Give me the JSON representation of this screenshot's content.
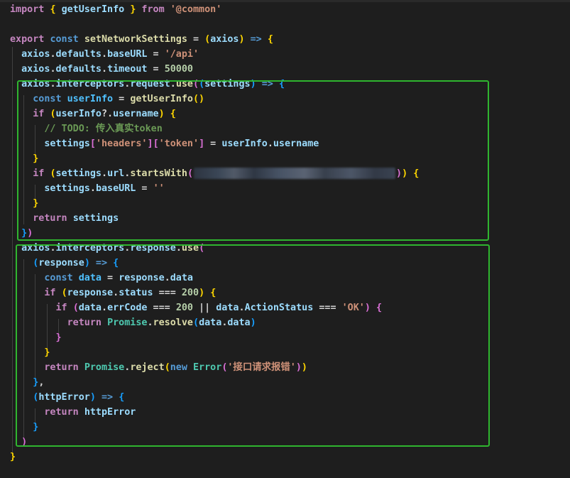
{
  "colors": {
    "background": "#1e1e1e",
    "keyword_purple": "#c586c0",
    "keyword_blue": "#569cd6",
    "variable": "#9cdcfe",
    "function": "#dcdcaa",
    "string": "#ce9178",
    "number": "#b5cea8",
    "comment": "#6a9955",
    "class": "#4ec9b0",
    "bracket_gold": "#ffd700",
    "bracket_pink": "#da70d6",
    "bracket_blue": "#179fff",
    "highlight_box": "#2fb52f"
  },
  "code": {
    "lines": [
      {
        "tokens": [
          {
            "t": "import ",
            "c": "#c586c0"
          },
          {
            "t": "{",
            "c": "#ffd700"
          },
          {
            "t": " ",
            "c": "#d4d4d4"
          },
          {
            "t": "getUserInfo",
            "c": "#9cdcfe"
          },
          {
            "t": " ",
            "c": "#d4d4d4"
          },
          {
            "t": "}",
            "c": "#ffd700"
          },
          {
            "t": " from ",
            "c": "#c586c0"
          },
          {
            "t": "'@common'",
            "c": "#ce9178"
          }
        ]
      },
      {
        "tokens": []
      },
      {
        "tokens": [
          {
            "t": "export ",
            "c": "#c586c0"
          },
          {
            "t": "const ",
            "c": "#569cd6"
          },
          {
            "t": "setNetworkSettings",
            "c": "#dcdcaa"
          },
          {
            "t": " = ",
            "c": "#d4d4d4"
          },
          {
            "t": "(",
            "c": "#ffd700"
          },
          {
            "t": "axios",
            "c": "#9cdcfe"
          },
          {
            "t": ")",
            "c": "#ffd700"
          },
          {
            "t": " => ",
            "c": "#569cd6"
          },
          {
            "t": "{",
            "c": "#ffd700"
          }
        ]
      },
      {
        "tokens": [
          {
            "t": "  axios",
            "c": "#9cdcfe"
          },
          {
            "t": ".",
            "c": "#d4d4d4"
          },
          {
            "t": "defaults",
            "c": "#9cdcfe"
          },
          {
            "t": ".",
            "c": "#d4d4d4"
          },
          {
            "t": "baseURL",
            "c": "#9cdcfe"
          },
          {
            "t": " = ",
            "c": "#d4d4d4"
          },
          {
            "t": "'/api'",
            "c": "#ce9178"
          }
        ]
      },
      {
        "tokens": [
          {
            "t": "  axios",
            "c": "#9cdcfe"
          },
          {
            "t": ".",
            "c": "#d4d4d4"
          },
          {
            "t": "defaults",
            "c": "#9cdcfe"
          },
          {
            "t": ".",
            "c": "#d4d4d4"
          },
          {
            "t": "timeout",
            "c": "#9cdcfe"
          },
          {
            "t": " = ",
            "c": "#d4d4d4"
          },
          {
            "t": "50000",
            "c": "#b5cea8"
          }
        ]
      },
      {
        "tokens": [
          {
            "t": "  axios",
            "c": "#9cdcfe"
          },
          {
            "t": ".",
            "c": "#d4d4d4"
          },
          {
            "t": "interceptors",
            "c": "#9cdcfe"
          },
          {
            "t": ".",
            "c": "#d4d4d4"
          },
          {
            "t": "request",
            "c": "#9cdcfe"
          },
          {
            "t": ".",
            "c": "#d4d4d4"
          },
          {
            "t": "use",
            "c": "#dcdcaa"
          },
          {
            "t": "(",
            "c": "#da70d6"
          },
          {
            "t": "(",
            "c": "#179fff"
          },
          {
            "t": "settings",
            "c": "#9cdcfe"
          },
          {
            "t": ")",
            "c": "#179fff"
          },
          {
            "t": " => ",
            "c": "#569cd6"
          },
          {
            "t": "{",
            "c": "#179fff"
          }
        ]
      },
      {
        "tokens": [
          {
            "t": "    const ",
            "c": "#569cd6"
          },
          {
            "t": "userInfo",
            "c": "#4fc1ff"
          },
          {
            "t": " = ",
            "c": "#d4d4d4"
          },
          {
            "t": "getUserInfo",
            "c": "#dcdcaa"
          },
          {
            "t": "()",
            "c": "#ffd700"
          }
        ]
      },
      {
        "tokens": [
          {
            "t": "    if ",
            "c": "#c586c0"
          },
          {
            "t": "(",
            "c": "#ffd700"
          },
          {
            "t": "userInfo",
            "c": "#9cdcfe"
          },
          {
            "t": "?.",
            "c": "#d4d4d4"
          },
          {
            "t": "username",
            "c": "#9cdcfe"
          },
          {
            "t": ")",
            "c": "#ffd700"
          },
          {
            "t": " ",
            "c": "#d4d4d4"
          },
          {
            "t": "{",
            "c": "#ffd700"
          }
        ]
      },
      {
        "tokens": [
          {
            "t": "      // TODO: 传入真实token",
            "c": "#6a9955"
          }
        ]
      },
      {
        "tokens": [
          {
            "t": "      settings",
            "c": "#9cdcfe"
          },
          {
            "t": "[",
            "c": "#da70d6"
          },
          {
            "t": "'headers'",
            "c": "#ce9178"
          },
          {
            "t": "]",
            "c": "#da70d6"
          },
          {
            "t": "[",
            "c": "#da70d6"
          },
          {
            "t": "'token'",
            "c": "#ce9178"
          },
          {
            "t": "]",
            "c": "#da70d6"
          },
          {
            "t": " = ",
            "c": "#d4d4d4"
          },
          {
            "t": "userInfo",
            "c": "#9cdcfe"
          },
          {
            "t": ".",
            "c": "#d4d4d4"
          },
          {
            "t": "username",
            "c": "#9cdcfe"
          }
        ]
      },
      {
        "tokens": [
          {
            "t": "    }",
            "c": "#ffd700"
          }
        ]
      },
      {
        "tokens": [
          {
            "t": "    if ",
            "c": "#c586c0"
          },
          {
            "t": "(",
            "c": "#ffd700"
          },
          {
            "t": "settings",
            "c": "#9cdcfe"
          },
          {
            "t": ".",
            "c": "#d4d4d4"
          },
          {
            "t": "url",
            "c": "#9cdcfe"
          },
          {
            "t": ".",
            "c": "#d4d4d4"
          },
          {
            "t": "startsWith",
            "c": "#dcdcaa"
          },
          {
            "t": "(",
            "c": "#da70d6"
          },
          {
            "t": "",
            "c": "#ce9178",
            "blur": true
          },
          {
            "t": ")",
            "c": "#da70d6"
          },
          {
            "t": ")",
            "c": "#ffd700"
          },
          {
            "t": " ",
            "c": "#d4d4d4"
          },
          {
            "t": "{",
            "c": "#ffd700"
          }
        ]
      },
      {
        "tokens": [
          {
            "t": "      settings",
            "c": "#9cdcfe"
          },
          {
            "t": ".",
            "c": "#d4d4d4"
          },
          {
            "t": "baseURL",
            "c": "#9cdcfe"
          },
          {
            "t": " = ",
            "c": "#d4d4d4"
          },
          {
            "t": "''",
            "c": "#ce9178"
          }
        ]
      },
      {
        "tokens": [
          {
            "t": "    }",
            "c": "#ffd700"
          }
        ]
      },
      {
        "tokens": [
          {
            "t": "    return ",
            "c": "#c586c0"
          },
          {
            "t": "settings",
            "c": "#9cdcfe"
          }
        ]
      },
      {
        "tokens": [
          {
            "t": "  }",
            "c": "#179fff"
          },
          {
            "t": ")",
            "c": "#da70d6"
          }
        ]
      },
      {
        "tokens": [
          {
            "t": "  axios",
            "c": "#9cdcfe"
          },
          {
            "t": ".",
            "c": "#d4d4d4"
          },
          {
            "t": "interceptors",
            "c": "#9cdcfe"
          },
          {
            "t": ".",
            "c": "#d4d4d4"
          },
          {
            "t": "response",
            "c": "#9cdcfe"
          },
          {
            "t": ".",
            "c": "#d4d4d4"
          },
          {
            "t": "use",
            "c": "#dcdcaa"
          },
          {
            "t": "(",
            "c": "#da70d6"
          }
        ]
      },
      {
        "tokens": [
          {
            "t": "    ",
            "c": "#d4d4d4"
          },
          {
            "t": "(",
            "c": "#179fff"
          },
          {
            "t": "response",
            "c": "#9cdcfe"
          },
          {
            "t": ")",
            "c": "#179fff"
          },
          {
            "t": " => ",
            "c": "#569cd6"
          },
          {
            "t": "{",
            "c": "#179fff"
          }
        ]
      },
      {
        "tokens": [
          {
            "t": "      const ",
            "c": "#569cd6"
          },
          {
            "t": "data",
            "c": "#4fc1ff"
          },
          {
            "t": " = ",
            "c": "#d4d4d4"
          },
          {
            "t": "response",
            "c": "#9cdcfe"
          },
          {
            "t": ".",
            "c": "#d4d4d4"
          },
          {
            "t": "data",
            "c": "#9cdcfe"
          }
        ]
      },
      {
        "tokens": [
          {
            "t": "      if ",
            "c": "#c586c0"
          },
          {
            "t": "(",
            "c": "#ffd700"
          },
          {
            "t": "response",
            "c": "#9cdcfe"
          },
          {
            "t": ".",
            "c": "#d4d4d4"
          },
          {
            "t": "status",
            "c": "#9cdcfe"
          },
          {
            "t": " === ",
            "c": "#d4d4d4"
          },
          {
            "t": "200",
            "c": "#b5cea8"
          },
          {
            "t": ")",
            "c": "#ffd700"
          },
          {
            "t": " ",
            "c": "#d4d4d4"
          },
          {
            "t": "{",
            "c": "#ffd700"
          }
        ]
      },
      {
        "tokens": [
          {
            "t": "        if ",
            "c": "#c586c0"
          },
          {
            "t": "(",
            "c": "#da70d6"
          },
          {
            "t": "data",
            "c": "#9cdcfe"
          },
          {
            "t": ".",
            "c": "#d4d4d4"
          },
          {
            "t": "errCode",
            "c": "#9cdcfe"
          },
          {
            "t": " === ",
            "c": "#d4d4d4"
          },
          {
            "t": "200",
            "c": "#b5cea8"
          },
          {
            "t": " || ",
            "c": "#d4d4d4"
          },
          {
            "t": "data",
            "c": "#9cdcfe"
          },
          {
            "t": ".",
            "c": "#d4d4d4"
          },
          {
            "t": "ActionStatus",
            "c": "#9cdcfe"
          },
          {
            "t": " === ",
            "c": "#d4d4d4"
          },
          {
            "t": "'OK'",
            "c": "#ce9178"
          },
          {
            "t": ")",
            "c": "#da70d6"
          },
          {
            "t": " ",
            "c": "#d4d4d4"
          },
          {
            "t": "{",
            "c": "#da70d6"
          }
        ]
      },
      {
        "tokens": [
          {
            "t": "          return ",
            "c": "#c586c0"
          },
          {
            "t": "Promise",
            "c": "#4ec9b0"
          },
          {
            "t": ".",
            "c": "#d4d4d4"
          },
          {
            "t": "resolve",
            "c": "#dcdcaa"
          },
          {
            "t": "(",
            "c": "#179fff"
          },
          {
            "t": "data",
            "c": "#9cdcfe"
          },
          {
            "t": ".",
            "c": "#d4d4d4"
          },
          {
            "t": "data",
            "c": "#9cdcfe"
          },
          {
            "t": ")",
            "c": "#179fff"
          }
        ]
      },
      {
        "tokens": [
          {
            "t": "        }",
            "c": "#da70d6"
          }
        ]
      },
      {
        "tokens": [
          {
            "t": "      }",
            "c": "#ffd700"
          }
        ]
      },
      {
        "tokens": [
          {
            "t": "      return ",
            "c": "#c586c0"
          },
          {
            "t": "Promise",
            "c": "#4ec9b0"
          },
          {
            "t": ".",
            "c": "#d4d4d4"
          },
          {
            "t": "reject",
            "c": "#dcdcaa"
          },
          {
            "t": "(",
            "c": "#ffd700"
          },
          {
            "t": "new ",
            "c": "#569cd6"
          },
          {
            "t": "Error",
            "c": "#4ec9b0"
          },
          {
            "t": "(",
            "c": "#da70d6"
          },
          {
            "t": "'接口请求报错'",
            "c": "#ce9178"
          },
          {
            "t": ")",
            "c": "#da70d6"
          },
          {
            "t": ")",
            "c": "#ffd700"
          }
        ]
      },
      {
        "tokens": [
          {
            "t": "    }",
            "c": "#179fff"
          },
          {
            "t": ",",
            "c": "#d4d4d4"
          }
        ]
      },
      {
        "tokens": [
          {
            "t": "    ",
            "c": "#d4d4d4"
          },
          {
            "t": "(",
            "c": "#179fff"
          },
          {
            "t": "httpError",
            "c": "#9cdcfe"
          },
          {
            "t": ")",
            "c": "#179fff"
          },
          {
            "t": " => ",
            "c": "#569cd6"
          },
          {
            "t": "{",
            "c": "#179fff"
          }
        ]
      },
      {
        "tokens": [
          {
            "t": "      return ",
            "c": "#c586c0"
          },
          {
            "t": "httpError",
            "c": "#9cdcfe"
          }
        ]
      },
      {
        "tokens": [
          {
            "t": "    }",
            "c": "#179fff"
          }
        ]
      },
      {
        "tokens": [
          {
            "t": "  )",
            "c": "#da70d6"
          }
        ]
      },
      {
        "tokens": [
          {
            "t": "}",
            "c": "#ffd700"
          }
        ]
      }
    ]
  }
}
